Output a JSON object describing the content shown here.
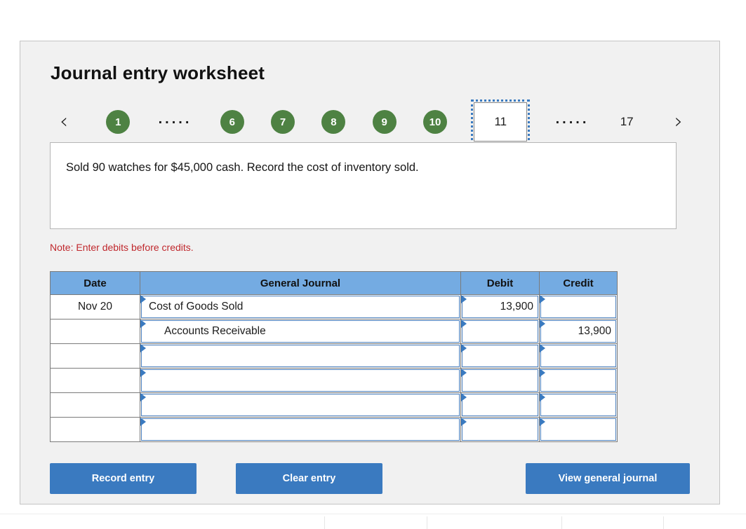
{
  "card": {
    "title": "Journal entry worksheet"
  },
  "step_nav": {
    "prev_icon": "chevron-left-icon",
    "prev_glyph": "‹",
    "next_icon": "chevron-right-icon",
    "next_glyph": "›",
    "ellipsis": ". . . . .",
    "steps": [
      {
        "label": "1",
        "type": "circle"
      },
      {
        "label": ".....",
        "type": "ellipsis"
      },
      {
        "label": "6",
        "type": "circle"
      },
      {
        "label": "7",
        "type": "circle"
      },
      {
        "label": "8",
        "type": "circle"
      },
      {
        "label": "9",
        "type": "circle"
      },
      {
        "label": "10",
        "type": "circle"
      },
      {
        "label": "11",
        "type": "active"
      },
      {
        "label": ".....",
        "type": "ellipsis"
      },
      {
        "label": "17",
        "type": "plain"
      }
    ]
  },
  "description": {
    "text": "Sold 90 watches for $45,000 cash. Record the cost of inventory sold."
  },
  "note": {
    "text": "Note: Enter debits before credits."
  },
  "journal": {
    "headers": {
      "date": "Date",
      "general_journal": "General Journal",
      "debit": "Debit",
      "credit": "Credit"
    },
    "rows": [
      {
        "date": "Nov 20",
        "account": "Cost of Goods Sold",
        "indent": false,
        "debit": "13,900",
        "credit": ""
      },
      {
        "date": "",
        "account": "Accounts Receivable",
        "indent": true,
        "debit": "",
        "credit": "13,900"
      },
      {
        "date": "",
        "account": "",
        "indent": false,
        "debit": "",
        "credit": ""
      },
      {
        "date": "",
        "account": "",
        "indent": false,
        "debit": "",
        "credit": ""
      },
      {
        "date": "",
        "account": "",
        "indent": false,
        "debit": "",
        "credit": ""
      },
      {
        "date": "",
        "account": "",
        "indent": false,
        "debit": "",
        "credit": ""
      }
    ]
  },
  "buttons": {
    "record_entry": "Record entry",
    "clear_entry": "Clear entry",
    "view_general_journal": "View general journal"
  },
  "colors": {
    "accent_blue": "#3a7ac0",
    "header_blue": "#74abe2",
    "step_green": "#4e8243",
    "note_red": "#c0282d",
    "card_bg": "#f1f1f1"
  },
  "bottom_strip": {
    "divider_positions": [
      462,
      608,
      800,
      945
    ]
  }
}
